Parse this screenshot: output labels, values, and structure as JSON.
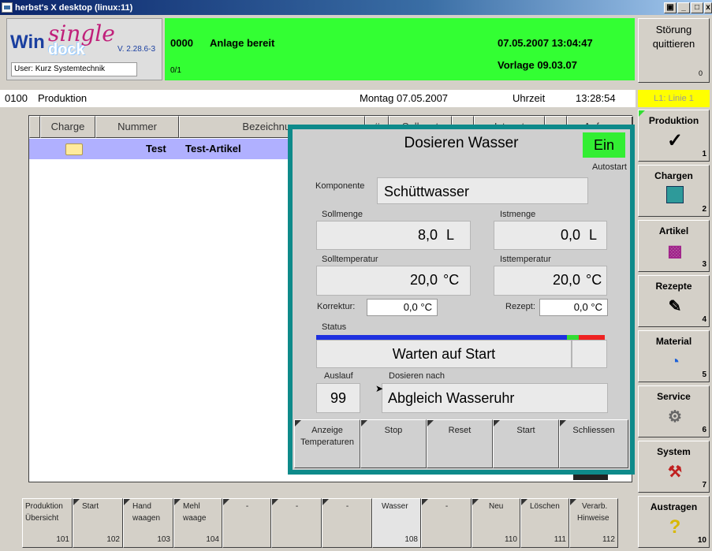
{
  "window": {
    "title": "herbst's X desktop (linux:11)",
    "buttons": [
      "▣",
      "_",
      "□",
      "x"
    ]
  },
  "logo": {
    "win": "Win",
    "single": "single",
    "dock": "dock",
    "version": "V. 2.28.6-3",
    "user_label": "User:",
    "user": "Kurz Systemtechnik"
  },
  "status": {
    "code": "0000",
    "message": "Anlage bereit",
    "count": "0/1",
    "datetime": "07.05.2007 13:04:47",
    "vorlage": "Vorlage 09.03.07",
    "color": "#33ff33"
  },
  "quit": {
    "label1": "Störung",
    "label2": "quittieren",
    "count": "0"
  },
  "section": {
    "code": "0100",
    "name": "Produktion",
    "date": "Montag 07.05.2007",
    "time_label": "Uhrzeit",
    "time": "13:28:54"
  },
  "line": {
    "label": "L1: Linie 1"
  },
  "table": {
    "headers": [
      "Charge",
      "Nummer",
      "Bezeichnung",
      "#",
      "Sollwert",
      "",
      "Istwert",
      "",
      "Anfang"
    ],
    "rows": [
      {
        "nummer": "Test",
        "bezeichnung": "Test-Artikel"
      }
    ]
  },
  "dialog": {
    "title": "Dosieren Wasser",
    "state": "Ein",
    "autostart": "Autostart",
    "komponente_label": "Komponente",
    "komponente": "Schüttwasser",
    "sollmenge_label": "Sollmenge",
    "sollmenge": "8,0",
    "istmenge_label": "Istmenge",
    "istmenge": "0,0",
    "unit_menge": "L",
    "solltemp_label": "Solltemperatur",
    "solltemp": "20,0",
    "isttemp_label": "Isttemperatur",
    "isttemp": "20,0",
    "unit_temp": "°C",
    "korrektur_label": "Korrektur:",
    "korrektur": "0,0",
    "rezept_label": "Rezept:",
    "rezept": "0,0",
    "status_label": "Status",
    "status": "Warten auf Start",
    "auslauf_label": "Auslauf",
    "auslauf": "99",
    "dosieren_label": "Dosieren nach",
    "dosieren": "Abgleich Wasseruhr",
    "buttons": {
      "anzeige1": "Anzeige",
      "anzeige2": "Temperaturen",
      "stop": "Stop",
      "reset": "Reset",
      "start": "Start",
      "schliessen": "Schliessen"
    }
  },
  "sidebar": [
    {
      "label": "Produktion",
      "num": "1",
      "icon": "checkmark-icon"
    },
    {
      "label": "Chargen",
      "num": "2",
      "icon": "chargen-icon"
    },
    {
      "label": "Artikel",
      "num": "3",
      "icon": "artikel-icon"
    },
    {
      "label": "Rezepte",
      "num": "4",
      "icon": "rezepte-icon"
    },
    {
      "label": "Material",
      "num": "5",
      "icon": "material-icon"
    },
    {
      "label": "Service",
      "num": "6",
      "icon": "gears-icon"
    },
    {
      "label": "System",
      "num": "7",
      "icon": "tools-icon"
    },
    {
      "label": "Austragen",
      "num": "10",
      "icon": "question-icon"
    }
  ],
  "bottom": [
    {
      "l1": "Produktion",
      "l2": "Übersicht",
      "num": "101"
    },
    {
      "l1": "Start",
      "l2": "",
      "num": "102"
    },
    {
      "l1": "Hand",
      "l2": "waagen",
      "num": "103"
    },
    {
      "l1": "Mehl",
      "l2": "waage",
      "num": "104"
    },
    {
      "l1": "-",
      "l2": "",
      "num": ""
    },
    {
      "l1": "-",
      "l2": "",
      "num": ""
    },
    {
      "l1": "-",
      "l2": "",
      "num": ""
    },
    {
      "l1": "Wasser",
      "l2": "",
      "num": "108"
    },
    {
      "l1": "-",
      "l2": "",
      "num": ""
    },
    {
      "l1": "Neu",
      "l2": "",
      "num": "110"
    },
    {
      "l1": "Löschen",
      "l2": "",
      "num": "111"
    },
    {
      "l1": "Verarb.",
      "l2": "Hinweise",
      "num": "112"
    }
  ]
}
